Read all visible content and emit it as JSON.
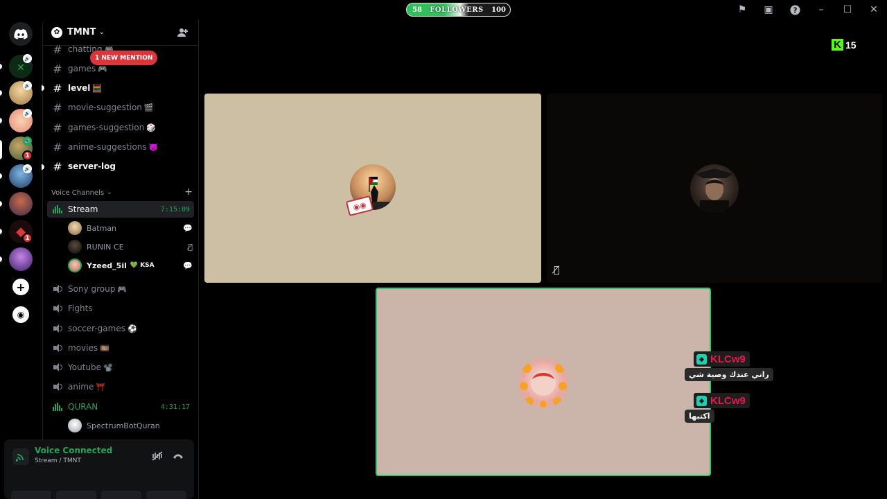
{
  "titlebar": {
    "followers": {
      "current": "58",
      "label": "FOLLOWERS",
      "goal": "100"
    },
    "icons": [
      "flag-icon",
      "inbox-icon",
      "help-icon",
      "minimize-icon",
      "maximize-icon",
      "close-icon"
    ]
  },
  "rail": {
    "badges": [
      "1",
      "1"
    ]
  },
  "guild": {
    "name": "TMNT"
  },
  "channels": {
    "mention": "1 NEW MENTION",
    "text": [
      {
        "name": "chatting",
        "emoji": "🎮"
      },
      {
        "name": "games",
        "emoji": "🎮"
      },
      {
        "name": "level",
        "emoji": "🧮"
      },
      {
        "name": "movie-suggestion",
        "emoji": "🎬"
      },
      {
        "name": "games-suggestion",
        "emoji": "🎲"
      },
      {
        "name": "anime-suggestions",
        "emoji": "👿"
      },
      {
        "name": "server-log",
        "emoji": ""
      }
    ],
    "voice_category": "Voice Channels",
    "voice": [
      {
        "name": "Stream",
        "timer": "7:15:09"
      },
      {
        "name": "Sony group",
        "emoji": "🎮"
      },
      {
        "name": "Fights",
        "emoji": ""
      },
      {
        "name": "soccer-games",
        "emoji": "⚽"
      },
      {
        "name": "movies",
        "emoji": "🎞️"
      },
      {
        "name": "Youtube",
        "emoji": "📽️"
      },
      {
        "name": "anime",
        "emoji": "⛩️"
      },
      {
        "name": "QURAN",
        "timer": "4:31:17"
      }
    ],
    "stream_users": [
      {
        "name": "Batman"
      },
      {
        "name": "RUNIN CE"
      },
      {
        "name": "Yzeed_5il",
        "tag": "💚 KSA"
      }
    ],
    "quran_users": [
      {
        "name": "SpectrumBotQuran"
      }
    ]
  },
  "voice_panel": {
    "title": "Voice Connected",
    "subtitle": "Stream / TMNT"
  },
  "stage": {
    "kick": {
      "letter": "K",
      "count": "15"
    },
    "chat": [
      {
        "user": "KLCw9",
        "text": "راني عندك وصية شي"
      },
      {
        "user": "KLCw9",
        "text": "اكتبها"
      }
    ]
  },
  "colors": {
    "accent_green": "#23a55a",
    "mention_red": "#da373c",
    "kick_green": "#53fc18",
    "chat_name": "#e8184e"
  }
}
